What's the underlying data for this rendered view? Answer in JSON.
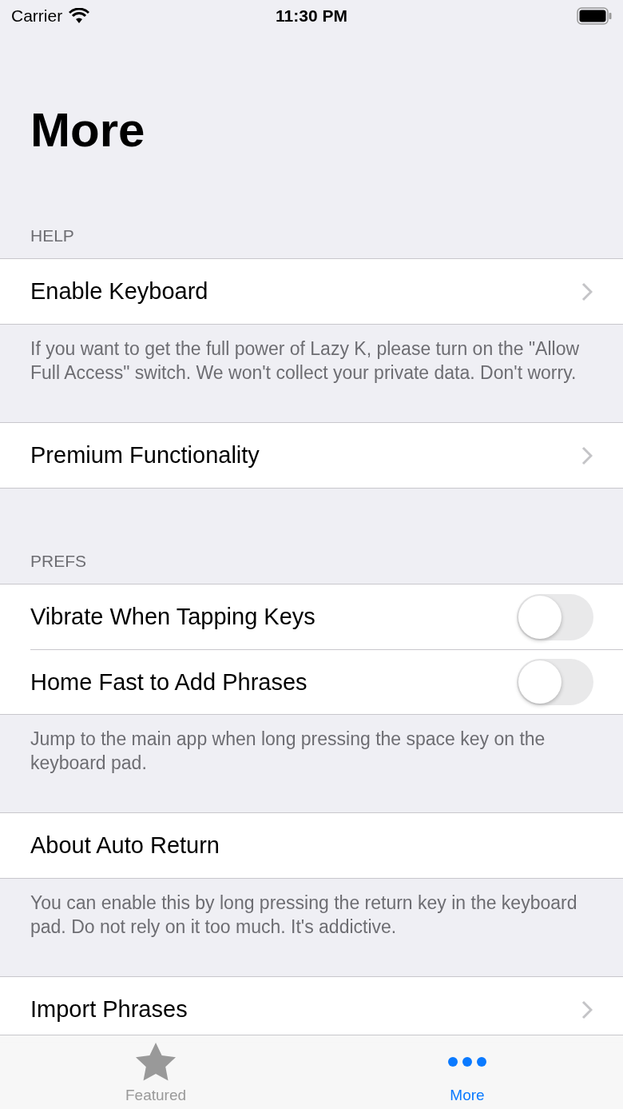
{
  "status_bar": {
    "carrier": "Carrier",
    "time": "11:30 PM"
  },
  "title": "More",
  "sections": [
    {
      "header": "HELP",
      "rows": [
        {
          "label": "Enable Keyboard",
          "kind": "link"
        }
      ],
      "footer": "If you want to get the full power of Lazy K, please turn on the \"Allow Full Access\" switch. We won't collect your private data. Don't worry."
    },
    {
      "rows": [
        {
          "label": "Premium Functionality",
          "kind": "link"
        }
      ]
    },
    {
      "header": "PREFS",
      "rows": [
        {
          "label": "Vibrate When Tapping Keys",
          "kind": "toggle",
          "on": false
        },
        {
          "label": "Home Fast to Add Phrases",
          "kind": "toggle",
          "on": false
        }
      ],
      "footer": "Jump to the main app when long pressing the space key on the keyboard pad."
    },
    {
      "rows": [
        {
          "label": "About Auto Return",
          "kind": "plain"
        }
      ],
      "footer": "You can enable this by long pressing the return key in the keyboard pad. Do not rely on it too much. It's addictive."
    },
    {
      "rows": [
        {
          "label": "Import Phrases",
          "kind": "link"
        }
      ]
    }
  ],
  "tabs": [
    {
      "label": "Featured",
      "kind": "star",
      "selected": false
    },
    {
      "label": "More",
      "kind": "dots",
      "selected": true
    }
  ]
}
